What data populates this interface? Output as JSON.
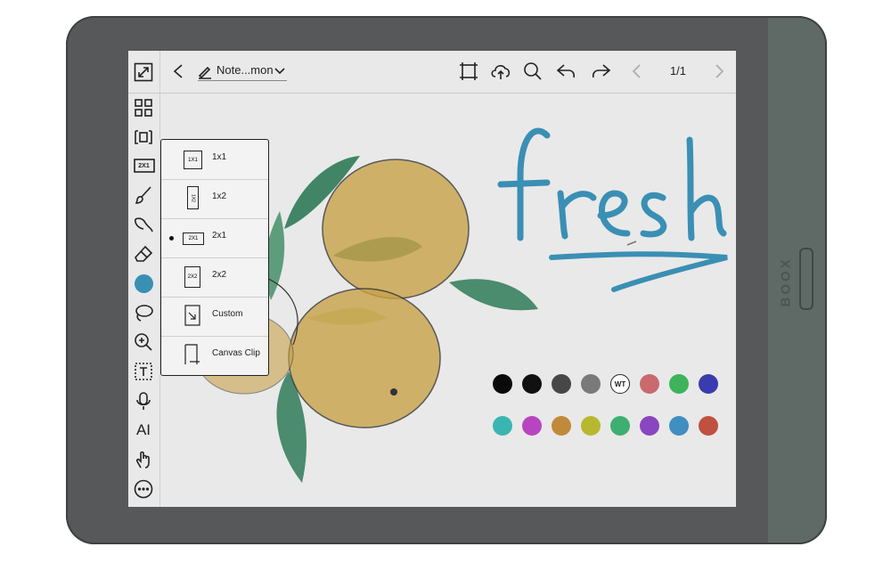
{
  "device": {
    "brand": "BOOX"
  },
  "topbar": {
    "title": "Note...mon",
    "page_indicator": "1/1",
    "icons": [
      "back-icon",
      "pen-edit-icon",
      "chevron-down-icon",
      "crop-icon",
      "cloud-upload-icon",
      "search-icon",
      "undo-icon",
      "redo-icon",
      "prev-page-icon",
      "next-page-icon"
    ]
  },
  "sidebar": {
    "icons": [
      "expand-icon",
      "grid-icon",
      "page-layout-icon",
      "split-layout-icon",
      "brush-icon",
      "shape-eraser-icon",
      "eraser-icon",
      "color-dot-icon",
      "lasso-icon",
      "zoom-in-icon",
      "text-box-icon",
      "microphone-icon",
      "ai-icon",
      "touch-hand-icon",
      "more-icon"
    ],
    "layout_badge": "2X1",
    "ai_label": "AI"
  },
  "layout_menu": {
    "items": [
      {
        "label": "1x1",
        "icon_text": "1X1",
        "selected": false
      },
      {
        "label": "1x2",
        "icon_text": "1X2",
        "selected": false
      },
      {
        "label": "2x1",
        "icon_text": "2X1",
        "selected": true
      },
      {
        "label": "2x2",
        "icon_text": "2X2",
        "selected": false
      },
      {
        "label": "Custom",
        "icon_text": "",
        "selected": false
      },
      {
        "label": "Canvas Clip",
        "icon_text": "",
        "selected": false
      }
    ]
  },
  "canvas": {
    "handwritten_word": "fresh",
    "accent_color": "#3a8fb4"
  },
  "palette": {
    "row1": [
      "#0a0a0a",
      "#111111",
      "#474747",
      "#7a7a7a",
      "WT",
      "#c96a6f",
      "#3db35c",
      "#3b3bb0"
    ],
    "row2": [
      "#3ab5b2",
      "#b845c0",
      "#c08a3a",
      "#b8b830",
      "#3eaf70",
      "#8a45c0",
      "#3f8fc0",
      "#c05040"
    ],
    "white_label": "WT"
  }
}
